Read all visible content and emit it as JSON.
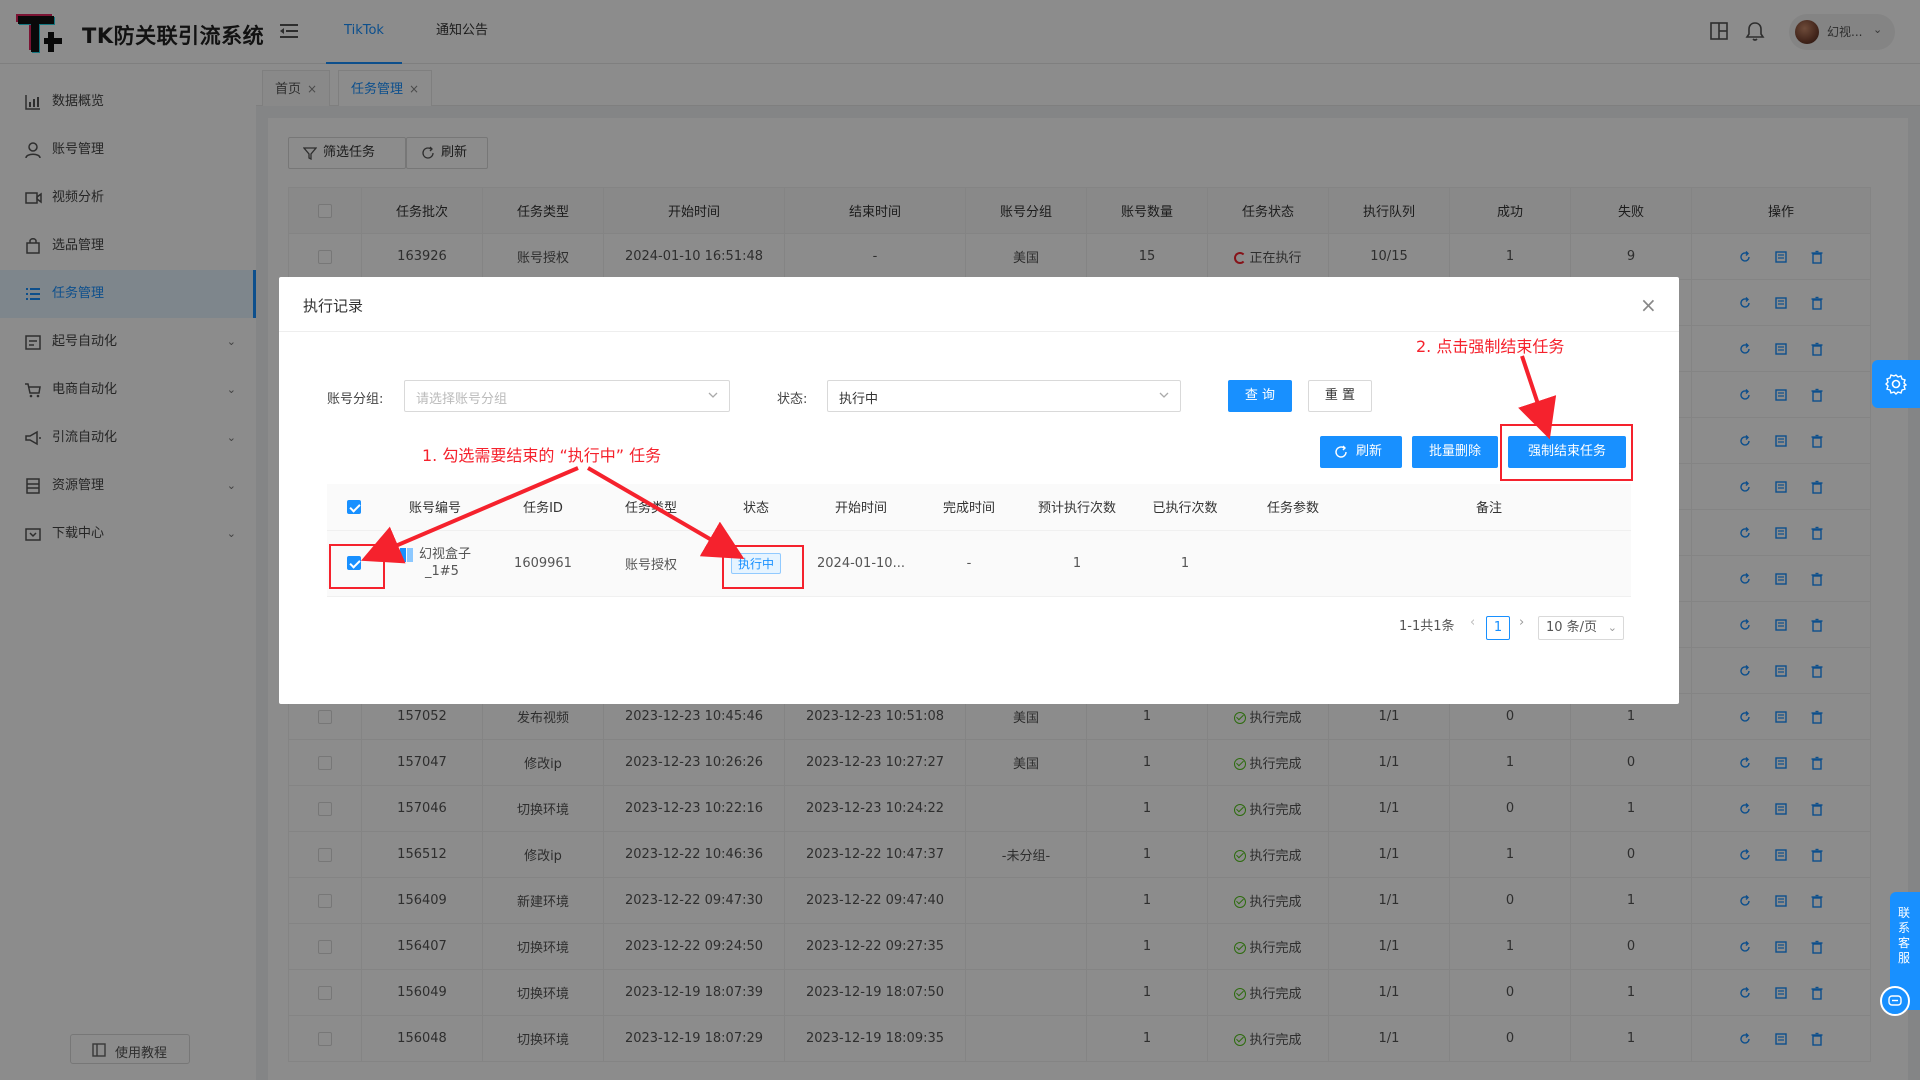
{
  "app": {
    "title": "TK防关联引流系统"
  },
  "header": {
    "tabs": [
      {
        "label": "TikTok"
      },
      {
        "label": "通知公告"
      }
    ],
    "user_name": "幻视...",
    "user_caret": "⌄"
  },
  "sidebar": {
    "items": [
      {
        "label": "数据概览",
        "icon": "bar-chart-icon"
      },
      {
        "label": "账号管理",
        "icon": "user-icon"
      },
      {
        "label": "视频分析",
        "icon": "video-icon"
      },
      {
        "label": "选品管理",
        "icon": "bag-icon"
      },
      {
        "label": "任务管理",
        "icon": "list-icon",
        "active": true
      },
      {
        "label": "起号自动化",
        "icon": "calendar-icon",
        "expandable": true
      },
      {
        "label": "电商自动化",
        "icon": "cart-icon",
        "expandable": true
      },
      {
        "label": "引流自动化",
        "icon": "megaphone-icon",
        "expandable": true
      },
      {
        "label": "资源管理",
        "icon": "database-icon",
        "expandable": true
      },
      {
        "label": "下载中心",
        "icon": "download-icon",
        "expandable": true
      }
    ],
    "tutorial_label": "使用教程",
    "arrow": "⌄"
  },
  "page_tabs": [
    {
      "label": "首页"
    },
    {
      "label": "任务管理"
    }
  ],
  "toolbar": {
    "filter_label": "筛选任务",
    "refresh_label": "刷新"
  },
  "main_table": {
    "columns": [
      "任务批次",
      "任务类型",
      "开始时间",
      "结束时间",
      "账号分组",
      "账号数量",
      "任务状态",
      "执行队列",
      "成功",
      "失败",
      "操作"
    ],
    "rows": [
      [
        "163926",
        "账号授权",
        "2024-01-10 16:51:48",
        "-",
        "美国",
        "15",
        "正在执行",
        "10/15",
        "1",
        "9"
      ],
      [
        "",
        "",
        "",
        "",
        "",
        "",
        "",
        "",
        "",
        ""
      ],
      [
        "",
        "",
        "",
        "",
        "",
        "",
        "",
        "",
        "",
        ""
      ],
      [
        "",
        "",
        "",
        "",
        "",
        "",
        "",
        "",
        "",
        ""
      ],
      [
        "",
        "",
        "",
        "",
        "",
        "",
        "",
        "",
        "",
        ""
      ],
      [
        "",
        "",
        "",
        "",
        "",
        "",
        "",
        "",
        "",
        ""
      ],
      [
        "",
        "",
        "",
        "",
        "",
        "",
        "",
        "",
        "",
        ""
      ],
      [
        "",
        "",
        "",
        "",
        "",
        "",
        "",
        "",
        "",
        ""
      ],
      [
        "",
        "",
        "",
        "",
        "",
        "",
        "",
        "",
        "",
        ""
      ],
      [
        "",
        "",
        "",
        "",
        "",
        "",
        "",
        "",
        "",
        ""
      ],
      [
        "157052",
        "发布视频",
        "2023-12-23 10:45:46",
        "2023-12-23 10:51:08",
        "美国",
        "1",
        "执行完成",
        "1/1",
        "0",
        "1"
      ],
      [
        "157047",
        "修改ip",
        "2023-12-23 10:26:26",
        "2023-12-23 10:27:27",
        "美国",
        "1",
        "执行完成",
        "1/1",
        "1",
        "0"
      ],
      [
        "157046",
        "切换环境",
        "2023-12-23 10:22:16",
        "2023-12-23 10:24:22",
        "",
        "1",
        "执行完成",
        "1/1",
        "0",
        "1"
      ],
      [
        "156512",
        "修改ip",
        "2023-12-22 10:46:36",
        "2023-12-22 10:47:37",
        "-未分组-",
        "1",
        "执行完成",
        "1/1",
        "1",
        "0"
      ],
      [
        "156409",
        "新建环境",
        "2023-12-22 09:47:30",
        "2023-12-22 09:47:40",
        "",
        "1",
        "执行完成",
        "1/1",
        "0",
        "1"
      ],
      [
        "156407",
        "切换环境",
        "2023-12-22 09:24:50",
        "2023-12-22 09:27:35",
        "",
        "1",
        "执行完成",
        "1/1",
        "1",
        "0"
      ],
      [
        "156049",
        "切换环境",
        "2023-12-19 18:07:39",
        "2023-12-19 18:07:50",
        "",
        "1",
        "执行完成",
        "1/1",
        "0",
        "1"
      ],
      [
        "156048",
        "切换环境",
        "2023-12-19 18:07:29",
        "2023-12-19 18:09:35",
        "",
        "1",
        "执行完成",
        "1/1",
        "0",
        "1"
      ]
    ]
  },
  "modal": {
    "title": "执行记录",
    "close": "×",
    "group_label": "账号分组:",
    "group_placeholder": "请选择账号分组",
    "status_label": "状态:",
    "status_value": "执行中",
    "query_label": "查 询",
    "reset_label": "重 置",
    "refresh_label": "刷新",
    "batch_delete_label": "批量删除",
    "force_end_label": "强制结束任务",
    "columns": [
      "账号编号",
      "任务ID",
      "任务类型",
      "状态",
      "开始时间",
      "完成时间",
      "预计执行次数",
      "已执行次数",
      "任务参数",
      "备注"
    ],
    "row": {
      "account_name": "幻视盒子",
      "account_suffix": "_1#5",
      "task_id": "1609961",
      "task_type": "账号授权",
      "status": "执行中",
      "start_time": "2024-01-10...",
      "end_time": "-",
      "expected_runs": "1",
      "executed_runs": "1",
      "params": "",
      "remark": ""
    },
    "pager": {
      "summary": "1-1共1条",
      "prev": "‹",
      "next": "›",
      "current": "1",
      "page_size": "10 条/页"
    }
  },
  "annotations": {
    "step1": "1. 勾选需要结束的 “执行中” 任务",
    "step2": "2. 点击强制结束任务"
  },
  "floating": {
    "customer_service": "联系客服"
  },
  "colors": {
    "primary": "#1890ff",
    "danger": "#f5222d",
    "success": "#52c41a",
    "annotation": "#f5222d"
  }
}
